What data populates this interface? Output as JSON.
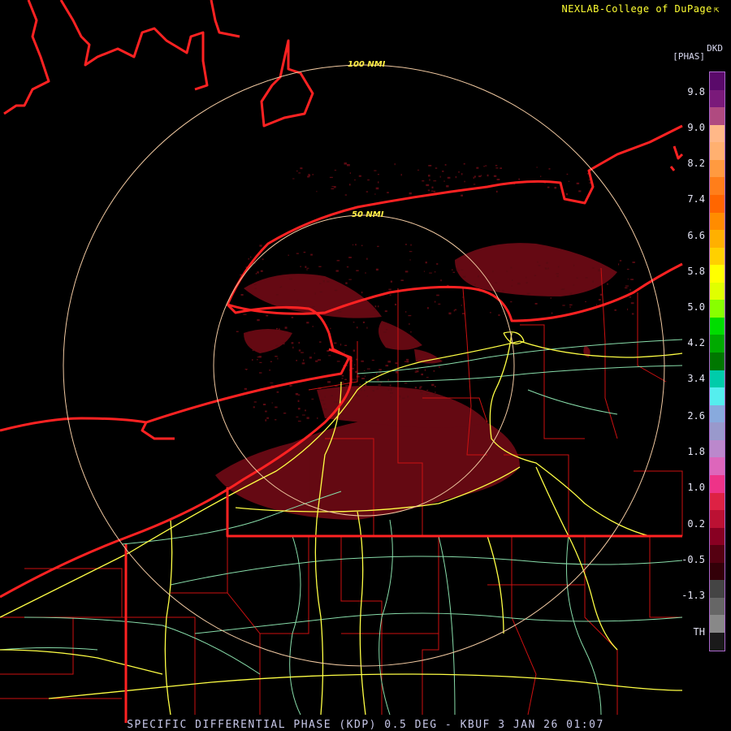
{
  "credit": {
    "text": "NEXLAB-College of DuPage",
    "icon": "external-link-icon"
  },
  "footer": {
    "title": "SPECIFIC DIFFERENTIAL PHASE (KDP) 0.5 DEG - KBUF 3 JAN 26 01:07"
  },
  "range_rings": [
    {
      "label": "50 NMI"
    },
    {
      "label": "100 NMI"
    }
  ],
  "legend": {
    "product": "DKD",
    "units": "[PHAS]",
    "labels": [
      "9.8",
      "9.0",
      "8.2",
      "7.4",
      "6.6",
      "5.8",
      "5.0",
      "4.2",
      "3.4",
      "2.6",
      "1.8",
      "1.0",
      "0.2",
      "-0.5",
      "-1.3",
      "TH"
    ],
    "colors": [
      "#5a0a6a",
      "#7a1a7a",
      "#b04a80",
      "#ffb888",
      "#ffb070",
      "#ff9a40",
      "#ff7e1a",
      "#ff6600",
      "#ff8c00",
      "#ffb000",
      "#ffd000",
      "#ffff00",
      "#e0ff00",
      "#88ff00",
      "#00dd00",
      "#00aa00",
      "#007700",
      "#00ccaa",
      "#55eeee",
      "#88aadd",
      "#9999cc",
      "#bb88cc",
      "#dd66bb",
      "#ee3388",
      "#dd2244",
      "#bb1133",
      "#880022",
      "#550011",
      "#330008",
      "#444444",
      "#666666",
      "#888888",
      "#1a1a1a"
    ]
  },
  "colors": {
    "coastline": "#ff2222",
    "county_lines": "#cc1111",
    "highways": "#ffff44",
    "roads": "#88ddaa",
    "range_ring": "#f0c8a0",
    "echo": "#6a0a14"
  }
}
